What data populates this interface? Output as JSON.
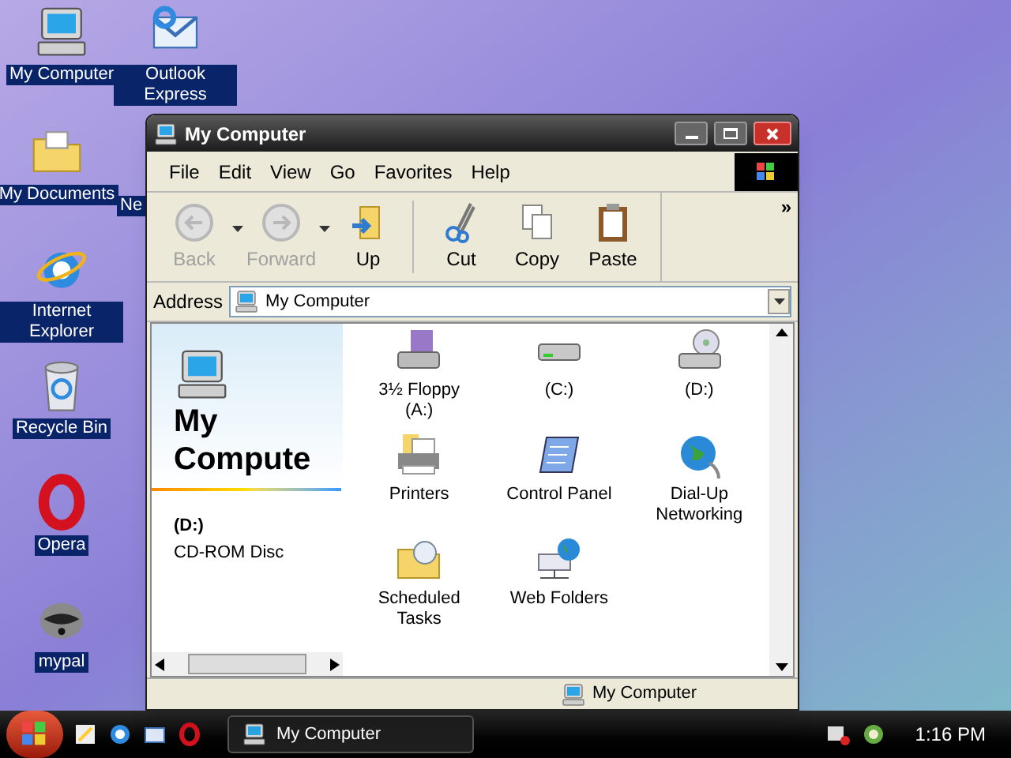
{
  "desktop_icons": [
    {
      "label": "My Computer"
    },
    {
      "label": "Outlook Express"
    },
    {
      "label": "My Documents"
    },
    {
      "label": "Ne"
    },
    {
      "label": "Internet Explorer"
    },
    {
      "label": "Recycle Bin"
    },
    {
      "label": "Opera"
    },
    {
      "label": "mypal"
    }
  ],
  "window": {
    "title": "My Computer",
    "menu": [
      "File",
      "Edit",
      "View",
      "Go",
      "Favorites",
      "Help"
    ],
    "toolbar": [
      {
        "label": "Back",
        "disabled": true,
        "dropdown": true
      },
      {
        "label": "Forward",
        "disabled": true,
        "dropdown": true
      },
      {
        "label": "Up",
        "disabled": false,
        "dropdown": false
      },
      {
        "label": "Cut",
        "disabled": false,
        "dropdown": false
      },
      {
        "label": "Copy",
        "disabled": false,
        "dropdown": false
      },
      {
        "label": "Paste",
        "disabled": false,
        "dropdown": false
      }
    ],
    "toolbar_more": "»",
    "address": {
      "label": "Address",
      "value": "My Computer"
    },
    "side_panel": {
      "title": "My Compute",
      "selection": "(D:)",
      "description": "CD-ROM Disc"
    },
    "items": [
      {
        "label": "3½ Floppy (A:)"
      },
      {
        "label": "(C:)"
      },
      {
        "label": "(D:)"
      },
      {
        "label": "Printers"
      },
      {
        "label": "Control Panel"
      },
      {
        "label": "Dial-Up Networking"
      },
      {
        "label": "Scheduled Tasks"
      },
      {
        "label": "Web Folders"
      }
    ],
    "status": "My Computer"
  },
  "taskbar": {
    "task": "My Computer",
    "clock": "1:16 PM"
  }
}
